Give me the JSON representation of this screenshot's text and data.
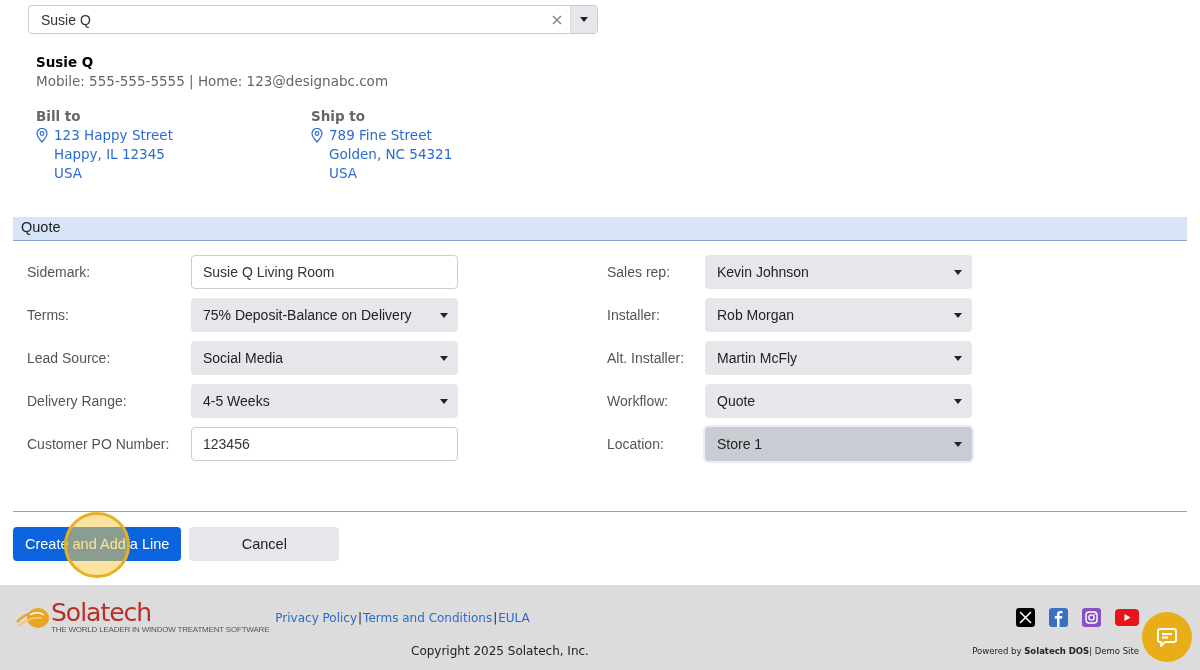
{
  "customer_select": {
    "value": "Susie Q"
  },
  "contact": {
    "name": "Susie Q",
    "details": "Mobile: 555-555-5555 | Home: 123@designabc.com"
  },
  "addresses": [
    {
      "heading": "Bill to",
      "lines": [
        "123 Happy Street",
        "Happy, IL 12345",
        "USA"
      ]
    },
    {
      "heading": "Ship to",
      "lines": [
        "789 Fine Street",
        "Golden, NC 54321",
        "USA"
      ]
    }
  ],
  "section": {
    "title": "Quote"
  },
  "left_fields": [
    {
      "label": "Sidemark:",
      "kind": "text",
      "value": "Susie Q Living Room"
    },
    {
      "label": "Terms:",
      "kind": "select",
      "value": "75% Deposit-Balance on Delivery"
    },
    {
      "label": "Lead Source:",
      "kind": "select",
      "value": "Social Media"
    },
    {
      "label": "Delivery Range:",
      "kind": "select",
      "value": "4-5 Weeks"
    },
    {
      "label": "Customer PO Number:",
      "kind": "text",
      "value": "123456"
    }
  ],
  "right_fields": [
    {
      "label": "Sales rep:",
      "kind": "select",
      "value": "Kevin Johnson",
      "focused": false
    },
    {
      "label": "Installer:",
      "kind": "select",
      "value": "Rob Morgan",
      "focused": false
    },
    {
      "label": "Alt. Installer:",
      "kind": "select",
      "value": "Martin McFly",
      "focused": false
    },
    {
      "label": "Workflow:",
      "kind": "select",
      "value": "Quote",
      "focused": false
    },
    {
      "label": "Location:",
      "kind": "select",
      "value": "Store 1",
      "focused": true
    }
  ],
  "buttons": [
    {
      "label": "Create and Add a Line",
      "kind": "primary"
    },
    {
      "label": "Cancel",
      "kind": "secondary"
    }
  ],
  "footer": {
    "logo_text": "Solatech",
    "logo_tagline": "THE WORLD LEADER IN WINDOW TREATMENT SOFTWARE",
    "links": [
      "Privacy Policy",
      "Terms and Conditions",
      "EULA"
    ],
    "link_separator": "|",
    "copyright": "Copyright 2025 Solatech, Inc.",
    "powered": "Powered by **Solatech DOS**| Demo Site"
  }
}
